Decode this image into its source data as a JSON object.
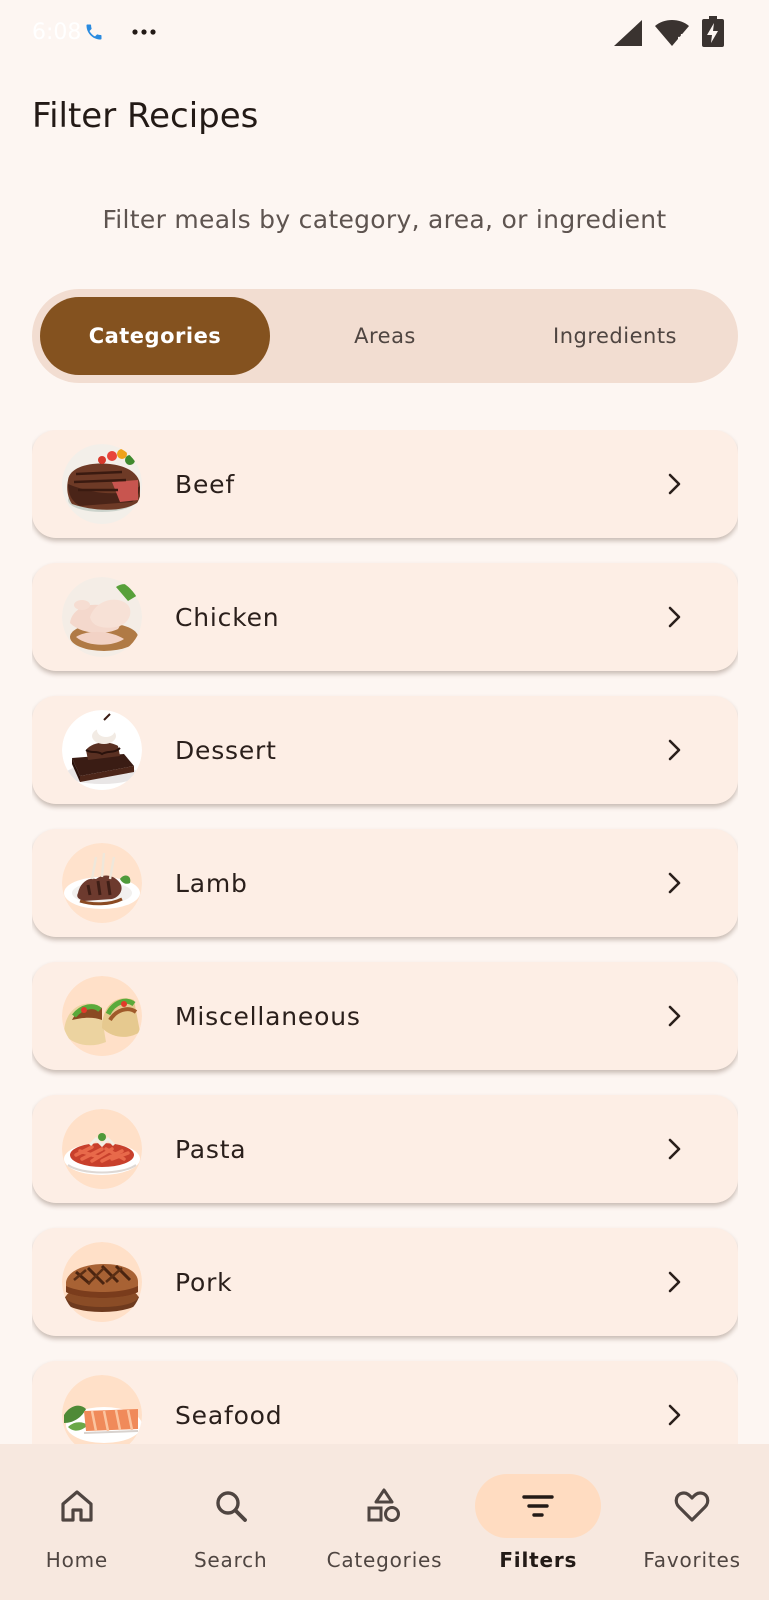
{
  "status_bar": {
    "time": "6:08",
    "icons": [
      "call-icon",
      "more-dots-icon",
      "signal-icon",
      "wifi-icon",
      "battery-charging-icon"
    ]
  },
  "header": {
    "title": "Filter Recipes",
    "subtitle": "Filter meals by category, area, or ingredient"
  },
  "tabs": [
    {
      "label": "Categories",
      "active": true
    },
    {
      "label": "Areas",
      "active": false
    },
    {
      "label": "Ingredients",
      "active": false
    }
  ],
  "categories": [
    {
      "label": "Beef",
      "image": "beef-steak-image"
    },
    {
      "label": "Chicken",
      "image": "raw-chicken-image"
    },
    {
      "label": "Dessert",
      "image": "chocolate-cake-image"
    },
    {
      "label": "Lamb",
      "image": "lamb-chops-image"
    },
    {
      "label": "Miscellaneous",
      "image": "tacos-image"
    },
    {
      "label": "Pasta",
      "image": "pasta-bowl-image"
    },
    {
      "label": "Pork",
      "image": "pork-steak-image"
    },
    {
      "label": "Seafood",
      "image": "salmon-plate-image"
    }
  ],
  "bottom_nav": [
    {
      "label": "Home",
      "icon": "home-icon",
      "active": false
    },
    {
      "label": "Search",
      "icon": "search-icon",
      "active": false
    },
    {
      "label": "Categories",
      "icon": "shapes-icon",
      "active": false
    },
    {
      "label": "Filters",
      "icon": "filter-icon",
      "active": true
    },
    {
      "label": "Favorites",
      "icon": "heart-icon",
      "active": false
    }
  ],
  "colors": {
    "background": "#fdf6f2",
    "accent": "#84521f",
    "tab_track": "#f2ddd1",
    "card": "#fdeee5",
    "nav_background": "#f7e8df",
    "nav_active_pill": "#ffdcc1"
  }
}
